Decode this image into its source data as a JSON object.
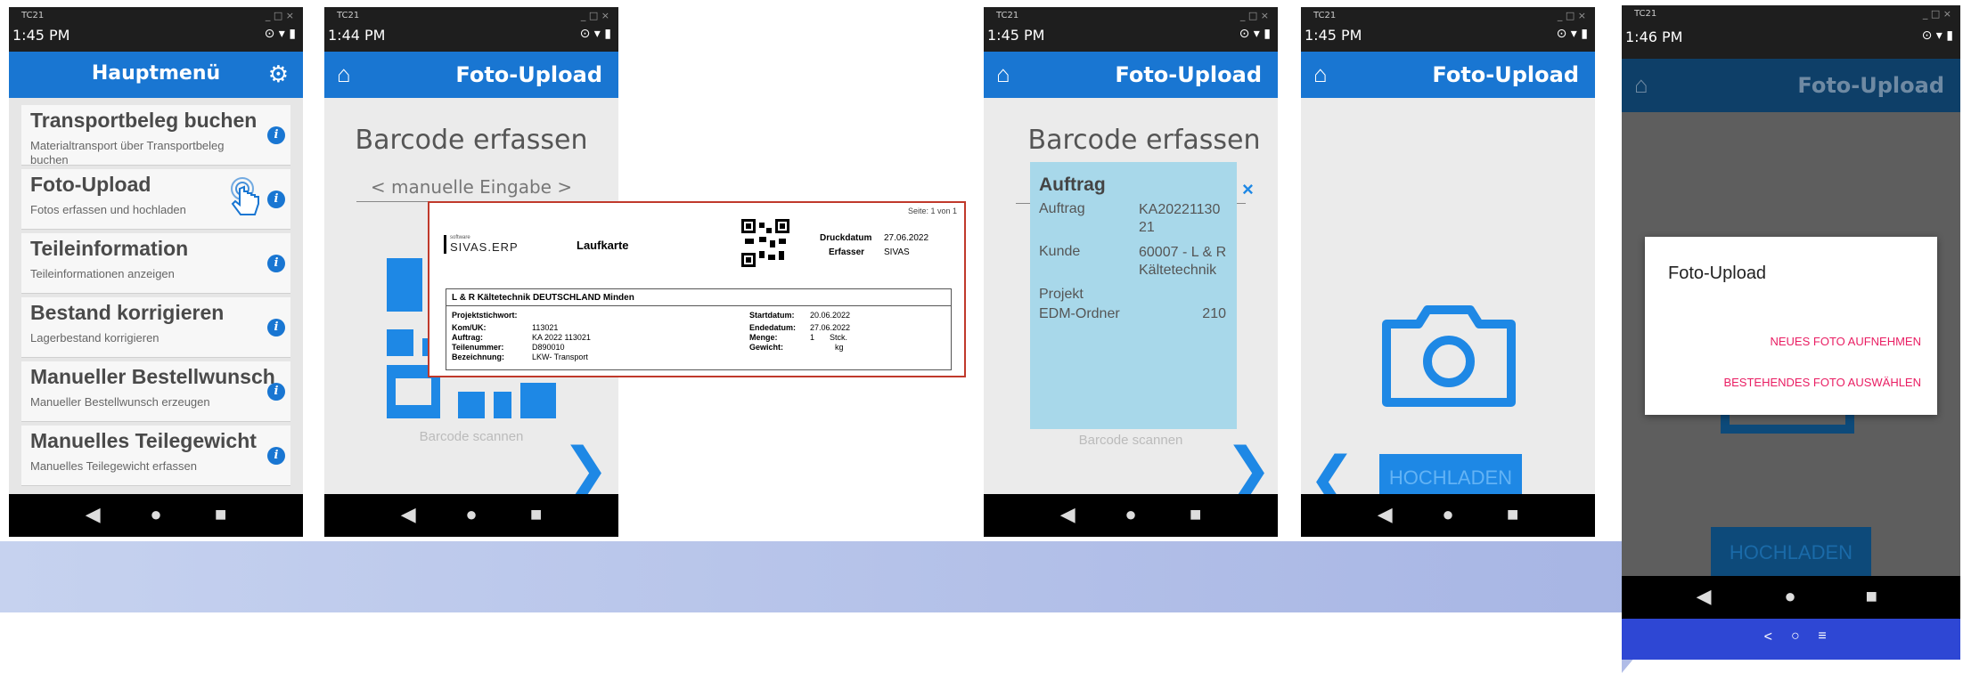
{
  "colors": {
    "accent": "#1976d2",
    "dialog_action": "#e91e63",
    "detail_bg": "#a8d8ea",
    "card_border": "#c0392b"
  },
  "status": {
    "top_left": "TC21",
    "win_controls": "_ □ ×"
  },
  "nav_icons": {
    "back": "◀",
    "home": "●",
    "recent": "■"
  },
  "menu_screen": {
    "time": "1:45 PM",
    "title": "Hauptmenü",
    "settings_icon": "gear-icon",
    "items": [
      {
        "title": "Transportbeleg buchen",
        "subtitle": "Materialtransport über Transportbeleg buchen"
      },
      {
        "title": "Foto-Upload",
        "subtitle": "Fotos erfassen und hochladen"
      },
      {
        "title": "Teileinformation",
        "subtitle": "Teileinformationen anzeigen"
      },
      {
        "title": "Bestand korrigieren",
        "subtitle": "Lagerbestand korrigieren"
      },
      {
        "title": "Manueller Bestellwunsch",
        "subtitle": "Manueller Bestellwunsch erzeugen"
      },
      {
        "title": "Manuelles Teilegewicht",
        "subtitle": "Manuelles Teilegewicht erfassen"
      }
    ],
    "info_glyph": "i"
  },
  "barcode_screen": {
    "time": "1:44 PM",
    "title": "Foto-Upload",
    "heading": "Barcode erfassen",
    "input_placeholder": "< manuelle Eingabe >",
    "scan_hint": "Barcode scannen",
    "next_glyph": "❯"
  },
  "laufkarte": {
    "page": "Seite: 1 von 1",
    "logo_small": "software",
    "logo": "SIVAS.ERP",
    "title": "Laufkarte",
    "druckdatum_label": "Druckdatum",
    "druckdatum": "27.06.2022",
    "erfasser_label": "Erfasser",
    "erfasser": "SIVAS",
    "company": "L & R Kältetechnik DEUTSCHLAND Minden",
    "projektstichwort_label": "Projektstichwort:",
    "komuk_label": "Kom/UK:",
    "komuk": "113021",
    "auftrag_label": "Auftrag:",
    "auftrag": "KA 2022 113021",
    "teilenummer_label": "Teilenummer:",
    "teilenummer": "D890010",
    "bezeichnung_label": "Bezeichnung:",
    "bezeichnung": "LKW- Transport",
    "startdatum_label": "Startdatum:",
    "startdatum": "20.06.2022",
    "endedatum_label": "Endedatum:",
    "endedatum": "27.06.2022",
    "menge_label": "Menge:",
    "menge": "1",
    "menge_unit": "Stck.",
    "gewicht_label": "Gewicht:",
    "gewicht_unit": "kg"
  },
  "auftrag_screen": {
    "time": "1:45 PM",
    "title": "Foto-Upload",
    "heading": "Barcode erfassen",
    "panel_title": "Auftrag",
    "close_glyph": "×",
    "rows": [
      {
        "label": "Auftrag",
        "value": "KA20221130\n21"
      },
      {
        "label": "Kunde",
        "value": "60007 - L & R\nKältetechnik"
      },
      {
        "label": "Projekt",
        "value": ""
      },
      {
        "label": "EDM-Ordner",
        "value": "210"
      }
    ],
    "scan_hint": "Barcode scannen"
  },
  "camera_screen": {
    "time": "1:45 PM",
    "title": "Foto-Upload",
    "camera_icon": "camera-icon",
    "upload_button": "HOCHLADEN",
    "back_glyph": "❮"
  },
  "dialog_screen": {
    "time": "1:46 PM",
    "title": "Foto-Upload",
    "dialog_title": "Foto-Upload",
    "action_new": "NEUES FOTO AUFNEHMEN",
    "action_existing": "BESTEHENDES FOTO AUSWÄHLEN",
    "upload_button": "HOCHLADEN",
    "sys_nav": {
      "back": "<",
      "home": "○",
      "menu": "≡"
    }
  }
}
